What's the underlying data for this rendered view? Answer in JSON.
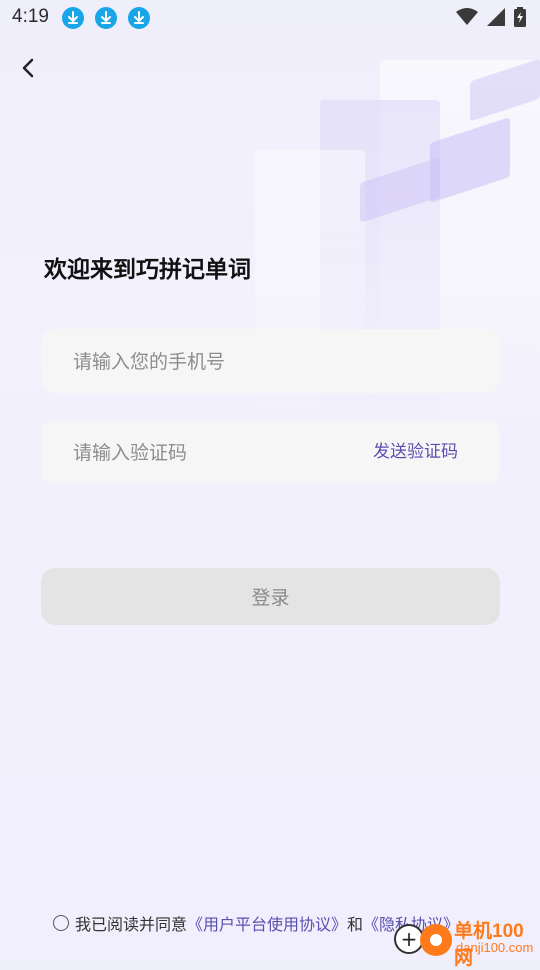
{
  "status_bar": {
    "time": "4:19",
    "download_icon_count": 3,
    "accent": "#19a6e8"
  },
  "header": {
    "back_icon": "chevron-left-icon"
  },
  "main": {
    "title": "欢迎来到巧拼记单词",
    "phone_field": {
      "value": "",
      "placeholder": "请输入您的手机号"
    },
    "code_field": {
      "value": "",
      "placeholder": "请输入验证码"
    },
    "send_code_label": "发送验证码",
    "login_label": "登录"
  },
  "agreement": {
    "checked": false,
    "prefix": "我已阅读并同意",
    "user_agreement": "《用户平台使用协议》",
    "and": "和",
    "privacy": "《隐私协议》"
  },
  "watermark": {
    "line1": "单机100网",
    "line2": "danji100.com"
  },
  "colors": {
    "link": "#5a4fb0",
    "button_disabled_bg": "#e4e4e4",
    "field_bg": "#f6f6f6"
  }
}
